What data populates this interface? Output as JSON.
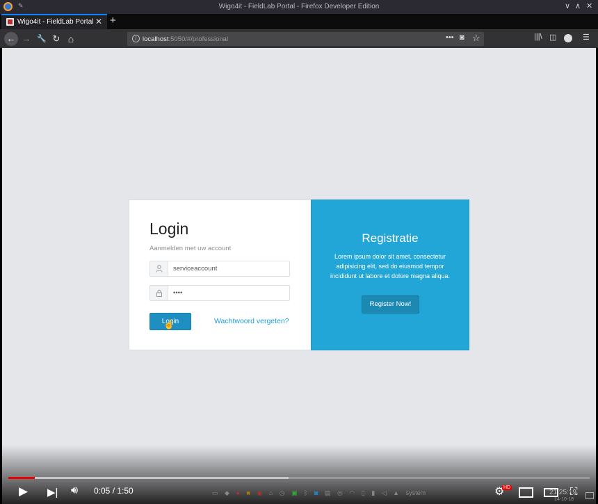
{
  "window": {
    "title": "Wigo4it - FieldLab Portal - Firefox Developer Edition",
    "controls": {
      "minimize": "∨",
      "maximize": "∧",
      "close": "✕"
    }
  },
  "tabs": [
    {
      "label": "Wigo4it - FieldLab Portal",
      "close": "✕"
    }
  ],
  "new_tab_label": "+",
  "navbar": {
    "back": "←",
    "forward": "→",
    "tools": "🔧",
    "reload": "↻",
    "home": "⌂",
    "url_host": "localhost",
    "url_rest": ":5050/#/professional",
    "page_actions": "•••",
    "pocket": "◙",
    "bookmark": "☆",
    "library": "|||\\",
    "sidebar": "◫",
    "menu": "☰"
  },
  "login": {
    "title": "Login",
    "subtitle": "Aanmelden met uw account",
    "username_value": "serviceaccount",
    "password_value": "••••",
    "submit_label": "Login",
    "forgot_label": "Wachtwoord vergeten?"
  },
  "registration": {
    "title": "Registratie",
    "text": "Lorem ipsum dolor sit amet, consectetur adipisicing elit, sed do eiusmod tempor incididunt ut labore et dolore magna aliqua.",
    "button_label": "Register Now!"
  },
  "player": {
    "time": "0:05 / 1:50",
    "progress_fraction": 0.045,
    "hd_badge": "HD",
    "clock": "21:25:19",
    "date": "14-10-18",
    "tray_label": "system"
  },
  "colors": {
    "accent": "#22a6d8",
    "button": "#1f8fc1",
    "progress": "#ee0000"
  }
}
